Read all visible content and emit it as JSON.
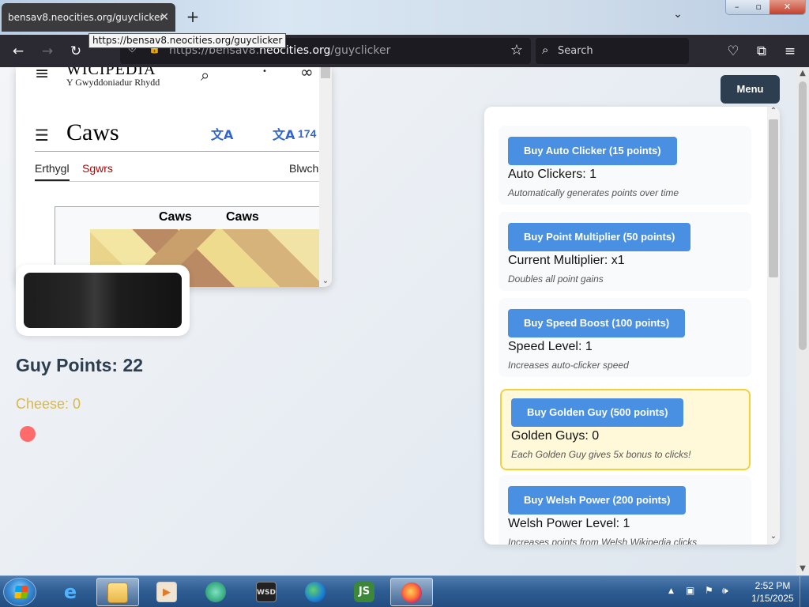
{
  "browser": {
    "tab_title": "bensav8.neocities.org/guyclicker",
    "tab_close": "✕",
    "new_tab": "+",
    "tab_list": "⌄",
    "tooltip": "https://bensav8.neocities.org/guyclicker",
    "url_prefix": "https://bensav8.",
    "url_domain": "neocities.org",
    "url_path": "/guyclicker",
    "search_placeholder": "Search",
    "icons": {
      "back": "←",
      "forward": "→",
      "reload": "↻",
      "star": "☆",
      "pocket": "♡",
      "extensions": "⧉",
      "menu": "≡",
      "search": "⌕",
      "shield": "⛨",
      "lock": "🔒"
    },
    "window_controls": {
      "minimize": "–",
      "maximize": "▫",
      "close": "✕"
    }
  },
  "page": {
    "menu_button": "Menu",
    "score_label": "Guy Points: 22",
    "cheese_label": "Cheese: 0",
    "wikipedia": {
      "logo": "WICIPEDIA",
      "tagline": "Y Gwyddoniadur Rhydd",
      "article_title": "Caws",
      "lang_count": "174",
      "tab_article": "Erthygl",
      "tab_talk": "Sgwrs",
      "tab_view": "Blwch",
      "infobox_title": "Caws",
      "infobox_title_dup": "Caws"
    },
    "upgrades": [
      {
        "button": "Buy Auto Clicker (15 points)",
        "stat": "Auto Clickers: 1",
        "desc": "Automatically generates points over time"
      },
      {
        "button": "Buy Point Multiplier (50 points)",
        "stat": "Current Multiplier: x1",
        "desc": "Doubles all point gains"
      },
      {
        "button": "Buy Speed Boost (100 points)",
        "stat": "Speed Level: 1",
        "desc": "Increases auto-clicker speed"
      },
      {
        "button": "Buy Golden Guy (500 points)",
        "stat": "Golden Guys: 0",
        "desc": "Each Golden Guy gives 5x bonus to clicks!"
      },
      {
        "button": "Buy Welsh Power (200 points)",
        "stat": "Welsh Power Level: 1",
        "desc": "Increases points from Welsh Wikipedia clicks"
      }
    ]
  },
  "taskbar": {
    "apps": [
      "start",
      "internet-explorer",
      "file-explorer",
      "media-player",
      "app-green",
      "wsd-app",
      "edge",
      "nodejs",
      "firefox"
    ],
    "clock_time": "2:52 PM",
    "clock_date": "1/15/2025",
    "tray_up": "▲"
  },
  "colors": {
    "accent_button": "#4a90e2",
    "menu_button": "#2c3e50",
    "golden_border": "#f4d03f",
    "cheese_text": "#d8b84a",
    "red_dot": "#ff6b6b"
  }
}
